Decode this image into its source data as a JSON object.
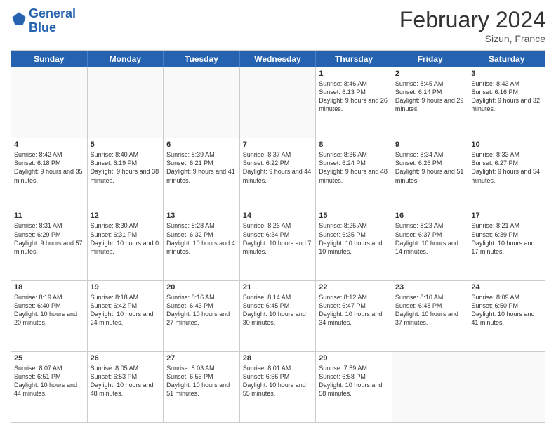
{
  "header": {
    "logo_line1": "General",
    "logo_line2": "Blue",
    "title": "February 2024",
    "subtitle": "Sizun, France"
  },
  "days_of_week": [
    "Sunday",
    "Monday",
    "Tuesday",
    "Wednesday",
    "Thursday",
    "Friday",
    "Saturday"
  ],
  "weeks": [
    [
      {
        "day": "",
        "content": ""
      },
      {
        "day": "",
        "content": ""
      },
      {
        "day": "",
        "content": ""
      },
      {
        "day": "",
        "content": ""
      },
      {
        "day": "1",
        "content": "Sunrise: 8:46 AM\nSunset: 6:13 PM\nDaylight: 9 hours and 26 minutes."
      },
      {
        "day": "2",
        "content": "Sunrise: 8:45 AM\nSunset: 6:14 PM\nDaylight: 9 hours and 29 minutes."
      },
      {
        "day": "3",
        "content": "Sunrise: 8:43 AM\nSunset: 6:16 PM\nDaylight: 9 hours and 32 minutes."
      }
    ],
    [
      {
        "day": "4",
        "content": "Sunrise: 8:42 AM\nSunset: 6:18 PM\nDaylight: 9 hours and 35 minutes."
      },
      {
        "day": "5",
        "content": "Sunrise: 8:40 AM\nSunset: 6:19 PM\nDaylight: 9 hours and 38 minutes."
      },
      {
        "day": "6",
        "content": "Sunrise: 8:39 AM\nSunset: 6:21 PM\nDaylight: 9 hours and 41 minutes."
      },
      {
        "day": "7",
        "content": "Sunrise: 8:37 AM\nSunset: 6:22 PM\nDaylight: 9 hours and 44 minutes."
      },
      {
        "day": "8",
        "content": "Sunrise: 8:36 AM\nSunset: 6:24 PM\nDaylight: 9 hours and 48 minutes."
      },
      {
        "day": "9",
        "content": "Sunrise: 8:34 AM\nSunset: 6:26 PM\nDaylight: 9 hours and 51 minutes."
      },
      {
        "day": "10",
        "content": "Sunrise: 8:33 AM\nSunset: 6:27 PM\nDaylight: 9 hours and 54 minutes."
      }
    ],
    [
      {
        "day": "11",
        "content": "Sunrise: 8:31 AM\nSunset: 6:29 PM\nDaylight: 9 hours and 57 minutes."
      },
      {
        "day": "12",
        "content": "Sunrise: 8:30 AM\nSunset: 6:31 PM\nDaylight: 10 hours and 0 minutes."
      },
      {
        "day": "13",
        "content": "Sunrise: 8:28 AM\nSunset: 6:32 PM\nDaylight: 10 hours and 4 minutes."
      },
      {
        "day": "14",
        "content": "Sunrise: 8:26 AM\nSunset: 6:34 PM\nDaylight: 10 hours and 7 minutes."
      },
      {
        "day": "15",
        "content": "Sunrise: 8:25 AM\nSunset: 6:35 PM\nDaylight: 10 hours and 10 minutes."
      },
      {
        "day": "16",
        "content": "Sunrise: 8:23 AM\nSunset: 6:37 PM\nDaylight: 10 hours and 14 minutes."
      },
      {
        "day": "17",
        "content": "Sunrise: 8:21 AM\nSunset: 6:39 PM\nDaylight: 10 hours and 17 minutes."
      }
    ],
    [
      {
        "day": "18",
        "content": "Sunrise: 8:19 AM\nSunset: 6:40 PM\nDaylight: 10 hours and 20 minutes."
      },
      {
        "day": "19",
        "content": "Sunrise: 8:18 AM\nSunset: 6:42 PM\nDaylight: 10 hours and 24 minutes."
      },
      {
        "day": "20",
        "content": "Sunrise: 8:16 AM\nSunset: 6:43 PM\nDaylight: 10 hours and 27 minutes."
      },
      {
        "day": "21",
        "content": "Sunrise: 8:14 AM\nSunset: 6:45 PM\nDaylight: 10 hours and 30 minutes."
      },
      {
        "day": "22",
        "content": "Sunrise: 8:12 AM\nSunset: 6:47 PM\nDaylight: 10 hours and 34 minutes."
      },
      {
        "day": "23",
        "content": "Sunrise: 8:10 AM\nSunset: 6:48 PM\nDaylight: 10 hours and 37 minutes."
      },
      {
        "day": "24",
        "content": "Sunrise: 8:09 AM\nSunset: 6:50 PM\nDaylight: 10 hours and 41 minutes."
      }
    ],
    [
      {
        "day": "25",
        "content": "Sunrise: 8:07 AM\nSunset: 6:51 PM\nDaylight: 10 hours and 44 minutes."
      },
      {
        "day": "26",
        "content": "Sunrise: 8:05 AM\nSunset: 6:53 PM\nDaylight: 10 hours and 48 minutes."
      },
      {
        "day": "27",
        "content": "Sunrise: 8:03 AM\nSunset: 6:55 PM\nDaylight: 10 hours and 51 minutes."
      },
      {
        "day": "28",
        "content": "Sunrise: 8:01 AM\nSunset: 6:56 PM\nDaylight: 10 hours and 55 minutes."
      },
      {
        "day": "29",
        "content": "Sunrise: 7:59 AM\nSunset: 6:58 PM\nDaylight: 10 hours and 58 minutes."
      },
      {
        "day": "",
        "content": ""
      },
      {
        "day": "",
        "content": ""
      }
    ]
  ]
}
